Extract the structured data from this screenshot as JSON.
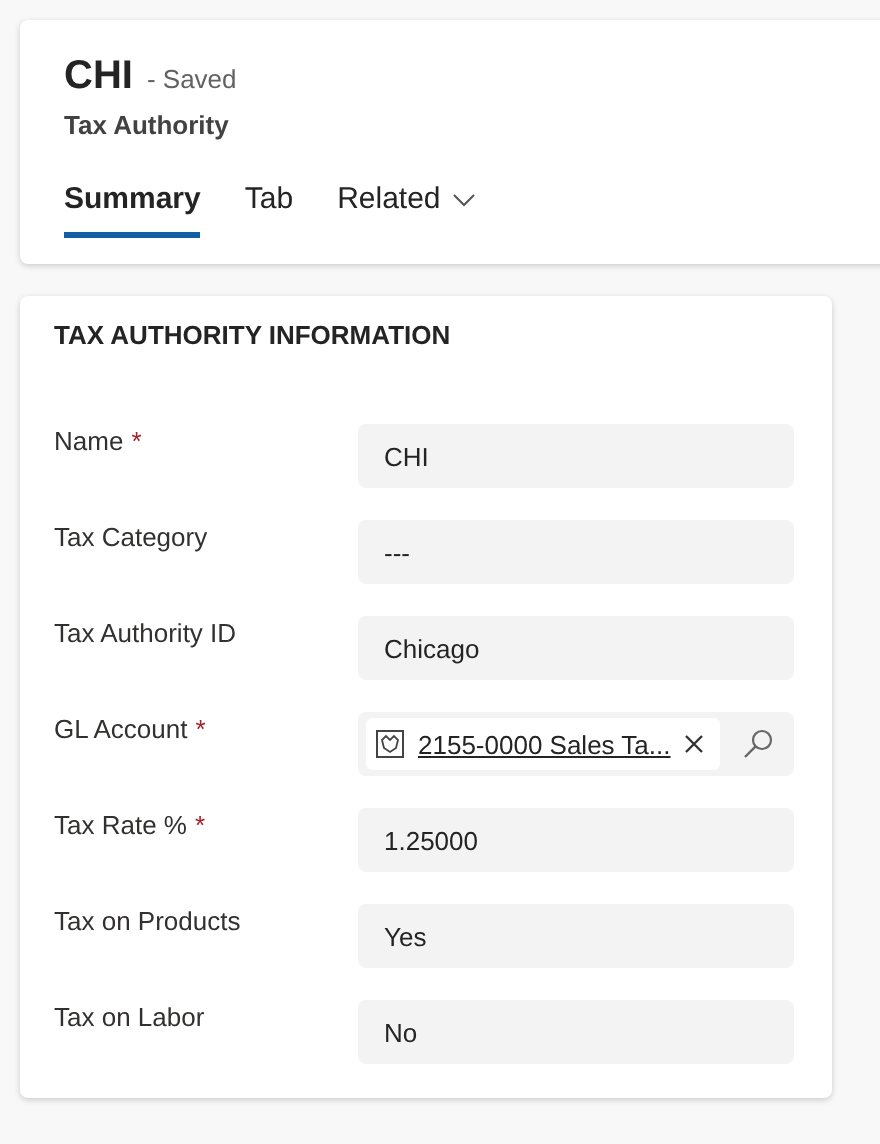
{
  "header": {
    "title": "CHI",
    "status": "- Saved",
    "entity": "Tax Authority"
  },
  "tabs": [
    {
      "label": "Summary",
      "selected": true,
      "dropdown": false
    },
    {
      "label": "Tab",
      "selected": false,
      "dropdown": false
    },
    {
      "label": "Related",
      "selected": false,
      "dropdown": true
    }
  ],
  "section": {
    "title": "TAX AUTHORITY INFORMATION",
    "fields": [
      {
        "kind": "text",
        "label": "Name",
        "marker": "*",
        "value": "CHI"
      },
      {
        "kind": "text",
        "label": "Tax Category",
        "value": "---"
      },
      {
        "kind": "text",
        "label": "Tax Authority ID",
        "value": "Chicago"
      },
      {
        "kind": "lookup",
        "label": "GL Account",
        "marker": "*",
        "value": "2155-0000 Sales Ta..."
      },
      {
        "kind": "text",
        "label": "Tax Rate %",
        "marker": "*",
        "value": "1.25000"
      },
      {
        "kind": "text",
        "label": "Tax on Products",
        "value": "Yes"
      },
      {
        "kind": "text",
        "label": "Tax on Labor",
        "value": "No"
      }
    ]
  }
}
